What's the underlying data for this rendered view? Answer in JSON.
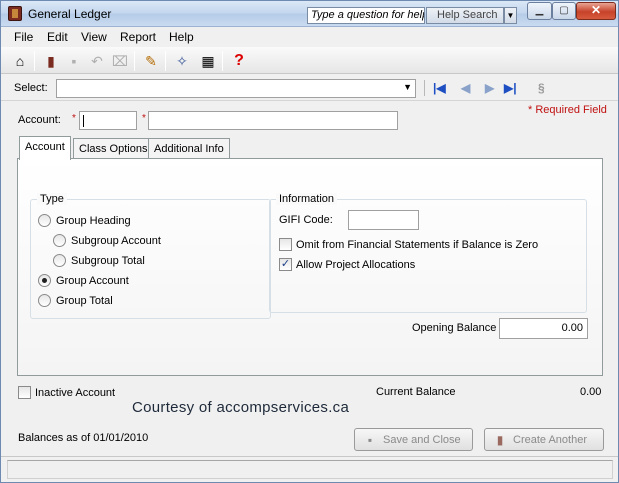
{
  "window": {
    "title": "General Ledger",
    "help_placeholder": "Type a question for help",
    "help_search": "Help Search"
  },
  "menu": [
    "File",
    "Edit",
    "View",
    "Report",
    "Help"
  ],
  "select": {
    "label": "Select:"
  },
  "required_note": "* Required Field",
  "account": {
    "label": "Account:",
    "number_value": "",
    "name_value": ""
  },
  "tabs": [
    "Account",
    "Class Options",
    "Additional Info"
  ],
  "type_group": {
    "title": "Type",
    "options": [
      {
        "label": "Group Heading",
        "selected": false
      },
      {
        "label": "Subgroup Account",
        "selected": false
      },
      {
        "label": "Subgroup Total",
        "selected": false
      },
      {
        "label": "Group Account",
        "selected": true
      },
      {
        "label": "Group Total",
        "selected": false
      }
    ]
  },
  "info_group": {
    "title": "Information",
    "gifi_label": "GIFI Code:",
    "gifi_value": "",
    "omit_label": "Omit from Financial Statements if Balance is Zero",
    "omit_checked": false,
    "allow_label": "Allow Project Allocations",
    "allow_checked": true
  },
  "opening_balance": {
    "label": "Opening Balance",
    "value": "0.00"
  },
  "inactive": {
    "label": "Inactive Account",
    "checked": false
  },
  "current_balance": {
    "label": "Current Balance",
    "value": "0.00"
  },
  "courtesy": "Courtesy of accompservices.ca",
  "balances_as_of": "Balances as of 01/01/2010",
  "buttons": {
    "save_close": "Save and Close",
    "create_another": "Create Another"
  },
  "colors": {
    "required": "#c01010",
    "nav": "#1d4fc2",
    "close": "#c7432a"
  }
}
